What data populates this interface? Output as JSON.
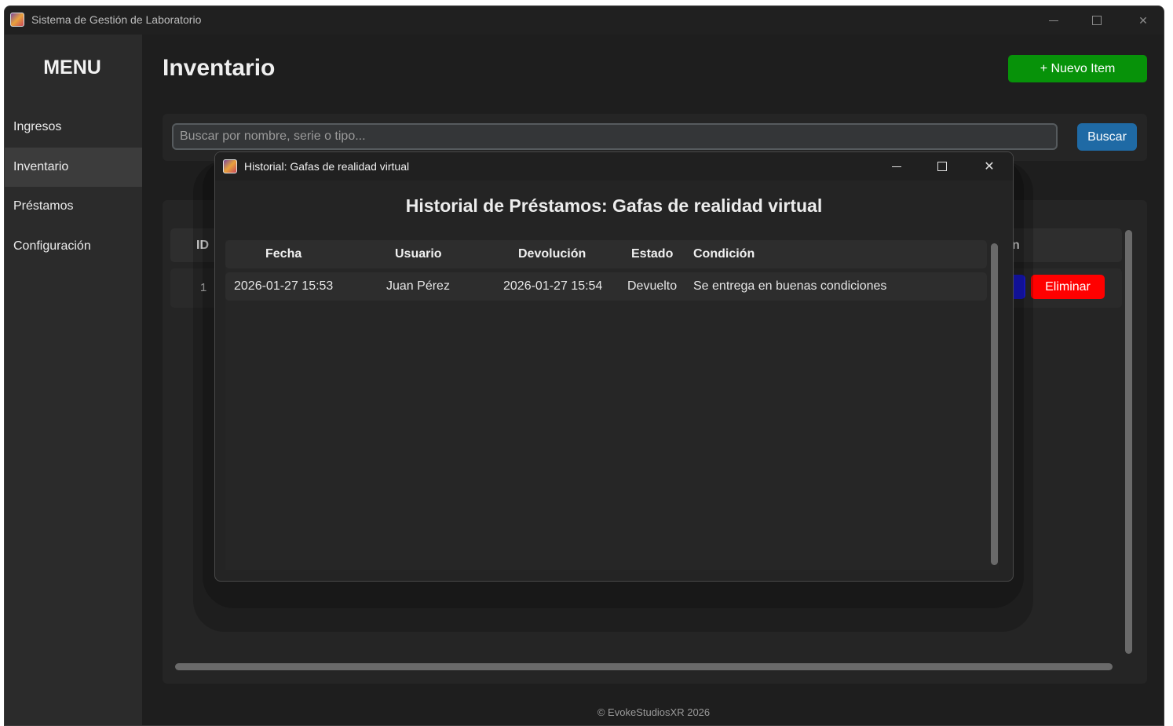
{
  "window": {
    "title": "Sistema de Gestión de Laboratorio"
  },
  "sidebar": {
    "title": "MENU",
    "items": [
      {
        "label": "Ingresos"
      },
      {
        "label": "Inventario"
      },
      {
        "label": "Préstamos"
      },
      {
        "label": "Configuración"
      }
    ],
    "active": "Inventario"
  },
  "page": {
    "title": "Inventario",
    "new_button": "+ Nuevo Item",
    "search_placeholder": "Buscar por nombre, serie o tipo...",
    "search_button": "Buscar"
  },
  "table": {
    "header_id": "ID",
    "header_partial": "n",
    "rows": [
      {
        "id": "1",
        "delete_label": "Eliminar"
      }
    ]
  },
  "footer": "© EvokeStudiosXR 2026",
  "dialog": {
    "title": "Historial: Gafas de realidad virtual",
    "heading": "Historial de Préstamos: Gafas de realidad virtual",
    "columns": [
      "Fecha",
      "Usuario",
      "Devolución",
      "Estado",
      "Condición"
    ],
    "rows": [
      {
        "fecha": "2026-01-27 15:53",
        "usuario": "Juan Pérez",
        "devolucion": "2026-01-27 15:54",
        "estado": "Devuelto",
        "condicion": "Se entrega en buenas condiciones"
      }
    ]
  },
  "colors": {
    "new_button": "#079209",
    "search_button": "#1f6aa5",
    "delete_button": "#ff0000",
    "edit_button": "#1a1ae0",
    "background": "#1e1e1e",
    "sidebar": "#2b2b2b"
  },
  "icons": {
    "app": "app-logo-icon",
    "minimize": "minimize-icon",
    "maximize": "maximize-icon",
    "close": "close-icon"
  }
}
